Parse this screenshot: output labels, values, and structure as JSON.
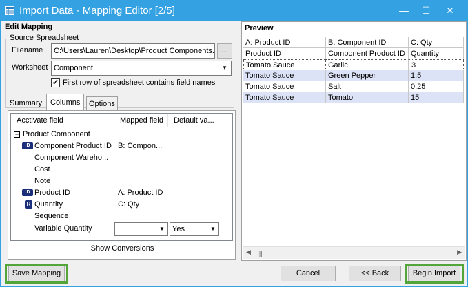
{
  "window": {
    "title": "Import Data - Mapping Editor [2/5]",
    "minimize_glyph": "—",
    "maximize_glyph": "☐",
    "close_glyph": "✕"
  },
  "edit_mapping": {
    "heading": "Edit Mapping",
    "source_group": "Source Spreadsheet",
    "filename_label": "Filename",
    "filename_value": "C:\\Users\\Lauren\\Desktop\\Product Components.x",
    "browse_label": "...",
    "worksheet_label": "Worksheet",
    "worksheet_value": "Component",
    "first_row_label": "First row of spreadsheet contains field names",
    "first_row_checked": true
  },
  "tabs": [
    "Summary",
    "Columns",
    "Options"
  ],
  "active_tab": "Columns",
  "columns_grid": {
    "headers": [
      "Acctivate field",
      "Mapped field",
      "Default va..."
    ],
    "group_label": "Product Component",
    "rows": [
      {
        "field": "Component Product ID",
        "mapped": "B: Compon...",
        "icon": "key-icon"
      },
      {
        "field": "Component Wareho...",
        "mapped": "",
        "icon": ""
      },
      {
        "field": "Cost",
        "mapped": "",
        "icon": ""
      },
      {
        "field": "Note",
        "mapped": "",
        "icon": ""
      },
      {
        "field": "Product ID",
        "mapped": "A: Product ID",
        "icon": "key-icon"
      },
      {
        "field": "Quantity",
        "mapped": "C: Qty",
        "icon": "required-icon"
      },
      {
        "field": "Sequence",
        "mapped": "",
        "icon": ""
      },
      {
        "field": "Variable Quantity",
        "mapped": "",
        "default": "Yes",
        "icon": ""
      }
    ],
    "key_icon_text": "ID",
    "required_icon_text": "R",
    "show_conversions": "Show Conversions"
  },
  "preview": {
    "heading": "Preview",
    "column_letters": [
      "A: Product ID",
      "B: Component ID",
      "C: Qty"
    ],
    "header_row": [
      "Product ID",
      "Component Product ID",
      "Quantity"
    ],
    "rows": [
      [
        "Tomato Sauce",
        "Garlic",
        "3"
      ],
      [
        "Tomato Sauce",
        "Green Pepper",
        "1.5"
      ],
      [
        "Tomato Sauce",
        "Salt",
        "0.25"
      ],
      [
        "Tomato Sauce",
        "Tomato",
        "15"
      ]
    ]
  },
  "buttons": {
    "save_mapping": "Save Mapping",
    "cancel": "Cancel",
    "back": "<< Back",
    "begin_import": "Begin Import"
  },
  "colors": {
    "titlebar": "#33a1e2",
    "highlight": "#53a53a",
    "selected_row": "#dde3f6"
  }
}
